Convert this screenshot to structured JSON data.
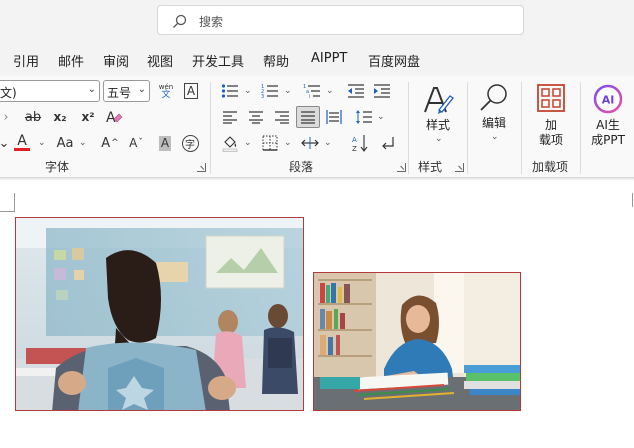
{
  "search": {
    "placeholder": "搜索"
  },
  "menu": {
    "items": [
      "引用",
      "邮件",
      "审阅",
      "视图",
      "开发工具",
      "帮助",
      "AIPPT",
      "百度网盘"
    ]
  },
  "font": {
    "name_value": "文)",
    "size_value": "五号",
    "phonetic_top": "wén",
    "phonetic_bottom": "文",
    "border_char": "A",
    "strike": "ab",
    "subscript": "x₂",
    "superscript": "x²",
    "clear_format": "A",
    "font_color": "A",
    "change_case": "Aa",
    "grow": "A",
    "shrink": "A",
    "shading_char": "A",
    "enclose_char": "字",
    "group_label": "字体"
  },
  "paragraph": {
    "group_label": "段落"
  },
  "styles": {
    "label": "样式",
    "group_label": "样式"
  },
  "editing": {
    "label": "编辑"
  },
  "addins": {
    "label_line1": "加",
    "label_line2": "载项",
    "group_label": "加载项"
  },
  "aippt": {
    "label_line1": "AI生",
    "label_line2": "成PPT",
    "logo": "AI"
  },
  "colors": {
    "font_color_underline": "#e41f1f",
    "addins_icon": "#c4442f",
    "ai_gradient_start": "#7b4ff2",
    "ai_gradient_end": "#e84fa5",
    "picture_border": "#b33b3b"
  },
  "document": {
    "pictures": [
      {
        "subject": "girl-with-backpack-in-classroom"
      },
      {
        "subject": "girl-writing-at-desk"
      }
    ]
  }
}
